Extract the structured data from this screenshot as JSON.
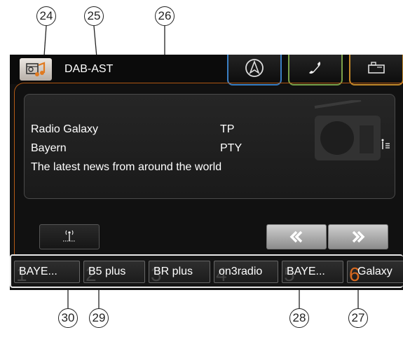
{
  "callouts": {
    "c24": "24",
    "c25": "25",
    "c26": "26",
    "c27": "27",
    "c28": "28",
    "c29": "29",
    "c30": "30"
  },
  "header": {
    "source_label": "DAB-AST",
    "source_icon": "radio-music-icon",
    "tabs": [
      {
        "name": "navigation",
        "icon": "navigation-arrow-icon",
        "color": "#3a7fc4"
      },
      {
        "name": "phone",
        "icon": "phone-handset-icon",
        "color": "#7aa24a"
      },
      {
        "name": "car",
        "icon": "car-functions-icon",
        "color": "#c48a2a"
      }
    ]
  },
  "station_info": {
    "station": "Radio Galaxy",
    "ensemble": "Bayern",
    "radiotext": "The latest news from around the world",
    "tp": "TP",
    "pty": "PTY"
  },
  "controls": {
    "antenna_icon": "antenna-signal-icon",
    "prev_icon": "seek-back-icon",
    "next_icon": "seek-forward-icon"
  },
  "presets": [
    {
      "num": "1",
      "label": "BAYE..."
    },
    {
      "num": "2",
      "label": "B5 plus"
    },
    {
      "num": "3",
      "label": "BR plus"
    },
    {
      "num": "4",
      "label": "on3radio"
    },
    {
      "num": "5",
      "label": "BAYE..."
    },
    {
      "num": "6",
      "label": "Galaxy",
      "active": true
    }
  ],
  "colors": {
    "accent_orange": "#d9691f",
    "frame_orange": "#b35a16"
  }
}
